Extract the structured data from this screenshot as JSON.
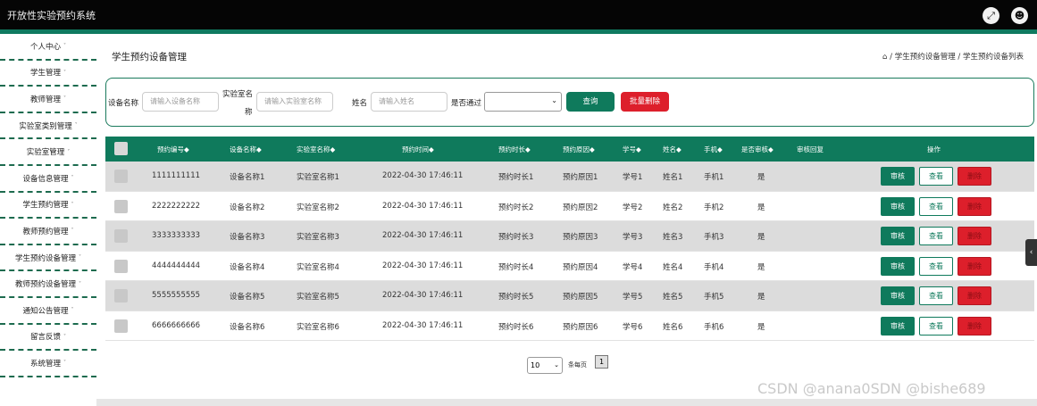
{
  "app": {
    "title": "开放性实验预约系统",
    "fullscreen_icon": "expand-icon",
    "user_icon": "user-icon"
  },
  "sidebar": {
    "items": [
      {
        "label": "个人中心"
      },
      {
        "label": "学生管理"
      },
      {
        "label": "教师管理"
      },
      {
        "label": "实验室类别管理"
      },
      {
        "label": "实验室管理"
      },
      {
        "label": "设备信息管理"
      },
      {
        "label": "学生预约管理"
      },
      {
        "label": "教师预约管理"
      },
      {
        "label": "学生预约设备管理"
      },
      {
        "label": "教师预约设备管理"
      },
      {
        "label": "通知公告管理"
      },
      {
        "label": "留言反馈"
      },
      {
        "label": "系统管理"
      }
    ],
    "caret": "˅"
  },
  "page": {
    "title": "学生预约设备管理",
    "breadcrumb": {
      "home_icon": "home-icon",
      "home_glyph": "⌂",
      "sep1": "/",
      "level1": "学生预约设备管理",
      "sep2": "/",
      "level2": "学生预约设备列表"
    }
  },
  "search": {
    "device_name_label": "设备名称",
    "device_name_placeholder": "请输入设备名称",
    "lab_name_label_1": "实验室名",
    "lab_name_label_2": "称",
    "lab_name_placeholder": "请输入实验室名称",
    "name_label": "姓名",
    "name_placeholder": "请输入姓名",
    "passed_label": "是否通过",
    "passed_value": "",
    "query_button": "查询",
    "batch_delete_button": "批量删除"
  },
  "table": {
    "columns": [
      "预约编号◆",
      "设备名称◆",
      "实验室名称◆",
      "预约时间◆",
      "预约时长◆",
      "预约原因◆",
      "学号◆",
      "姓名◆",
      "手机◆",
      "是否审核◆",
      "审核回复",
      "操作"
    ],
    "rows": [
      {
        "id": "1111111111",
        "device": "设备名称1",
        "lab": "实验室名称1",
        "time": "2022-04-30 17:46:11",
        "duration": "预约时长1",
        "reason": "预约原因1",
        "sno": "学号1",
        "name": "姓名1",
        "phone": "手机1",
        "audited": "是",
        "reply": ""
      },
      {
        "id": "2222222222",
        "device": "设备名称2",
        "lab": "实验室名称2",
        "time": "2022-04-30 17:46:11",
        "duration": "预约时长2",
        "reason": "预约原因2",
        "sno": "学号2",
        "name": "姓名2",
        "phone": "手机2",
        "audited": "是",
        "reply": ""
      },
      {
        "id": "3333333333",
        "device": "设备名称3",
        "lab": "实验室名称3",
        "time": "2022-04-30 17:46:11",
        "duration": "预约时长3",
        "reason": "预约原因3",
        "sno": "学号3",
        "name": "姓名3",
        "phone": "手机3",
        "audited": "是",
        "reply": ""
      },
      {
        "id": "4444444444",
        "device": "设备名称4",
        "lab": "实验室名称4",
        "time": "2022-04-30 17:46:11",
        "duration": "预约时长4",
        "reason": "预约原因4",
        "sno": "学号4",
        "name": "姓名4",
        "phone": "手机4",
        "audited": "是",
        "reply": ""
      },
      {
        "id": "5555555555",
        "device": "设备名称5",
        "lab": "实验室名称5",
        "time": "2022-04-30 17:46:11",
        "duration": "预约时长5",
        "reason": "预约原因5",
        "sno": "学号5",
        "name": "姓名5",
        "phone": "手机5",
        "audited": "是",
        "reply": ""
      },
      {
        "id": "6666666666",
        "device": "设备名称6",
        "lab": "实验室名称6",
        "time": "2022-04-30 17:46:11",
        "duration": "预约时长6",
        "reason": "预约原因6",
        "sno": "学号6",
        "name": "姓名6",
        "phone": "手机6",
        "audited": "是",
        "reply": ""
      }
    ],
    "actions": {
      "audit": "审核",
      "view": "查看",
      "delete": "删除"
    }
  },
  "pagination": {
    "page_size": "10",
    "per_page_label": "条每页",
    "current_page": "1"
  },
  "watermark": "CSDN @anana0SDN @bishe689",
  "colors": {
    "primary": "#0f7a5c",
    "danger": "#dd1f2b",
    "topbar": "#050505"
  }
}
